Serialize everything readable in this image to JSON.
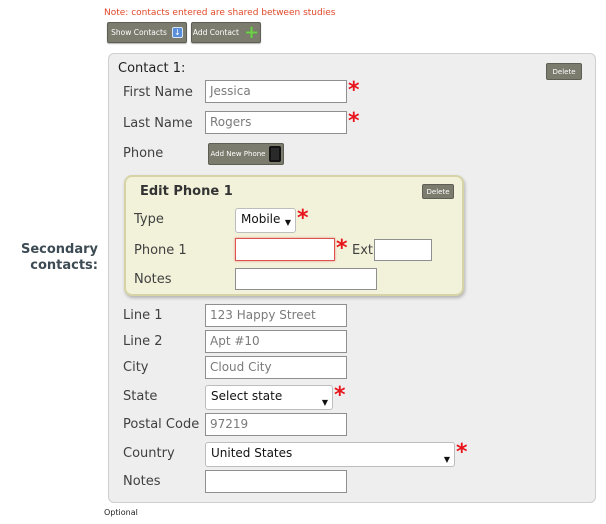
{
  "note": "Note: contacts entered are shared between studies",
  "toolbar": {
    "show_contacts": "Show Contacts",
    "add_contact": "Add Contact"
  },
  "section_label": "Secondary contacts:",
  "contact": {
    "title": "Contact 1:",
    "delete_label": "Delete",
    "first_name": {
      "label": "First Name",
      "value": "Jessica"
    },
    "last_name": {
      "label": "Last Name",
      "value": "Rogers"
    },
    "phone": {
      "label": "Phone",
      "add_new_phone": "Add New Phone"
    },
    "edit_phone": {
      "title": "Edit Phone 1",
      "delete_label": "Delete",
      "type": {
        "label": "Type",
        "selected": "Mobile"
      },
      "phone": {
        "label": "Phone 1",
        "value": ""
      },
      "ext": {
        "label": "Ext",
        "value": ""
      },
      "notes": {
        "label": "Notes",
        "value": ""
      }
    },
    "line1": {
      "label": "Line 1",
      "placeholder": "123 Happy Street"
    },
    "line2": {
      "label": "Line 2",
      "placeholder": "Apt #10"
    },
    "city": {
      "label": "City",
      "placeholder": "Cloud City"
    },
    "state": {
      "label": "State",
      "selected": "Select state"
    },
    "postal_code": {
      "label": "Postal Code",
      "placeholder": "97219"
    },
    "country": {
      "label": "Country",
      "selected": "United States"
    },
    "notes": {
      "label": "Notes",
      "value": ""
    }
  },
  "optional_label": "Optional",
  "colors": {
    "required": "#e8141c",
    "note": "#e04a2a",
    "button": "#7b7b6e",
    "phone_panel": "#f2f1d9"
  }
}
